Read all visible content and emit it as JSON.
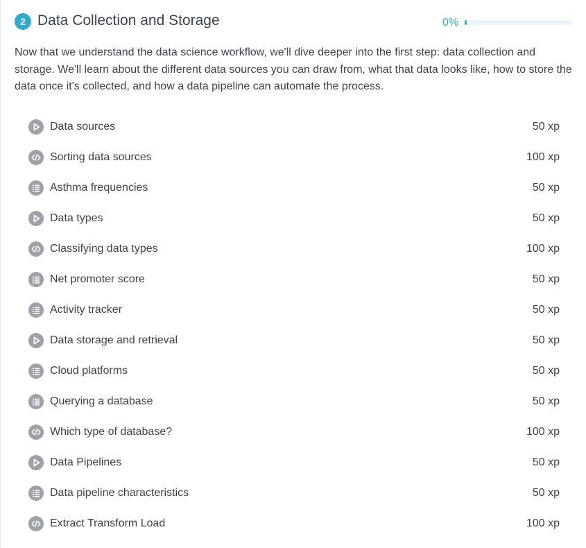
{
  "chapter": {
    "number": "2",
    "title": "Data Collection and Storage",
    "progress_label": "0%",
    "progress_value": 0,
    "accent_color": "#33aacc",
    "description": "Now that we understand the data science workflow, we'll dive deeper into the first step: data collection and storage. We'll learn about the different data sources you can draw from, what that data looks like, how to store the data once it's collected, and how a data pipeline can automate the process."
  },
  "exercises": [
    {
      "title": "Data sources",
      "xp": "50 xp",
      "icon": "video-play-icon"
    },
    {
      "title": "Sorting data sources",
      "xp": "100 xp",
      "icon": "code-icon"
    },
    {
      "title": "Asthma frequencies",
      "xp": "50 xp",
      "icon": "multiple-choice-list-icon"
    },
    {
      "title": "Data types",
      "xp": "50 xp",
      "icon": "video-play-icon"
    },
    {
      "title": "Classifying data types",
      "xp": "100 xp",
      "icon": "code-icon"
    },
    {
      "title": "Net promoter score",
      "xp": "50 xp",
      "icon": "multiple-choice-list-icon"
    },
    {
      "title": "Activity tracker",
      "xp": "50 xp",
      "icon": "multiple-choice-list-icon"
    },
    {
      "title": "Data storage and retrieval",
      "xp": "50 xp",
      "icon": "video-play-icon"
    },
    {
      "title": "Cloud platforms",
      "xp": "50 xp",
      "icon": "multiple-choice-list-icon"
    },
    {
      "title": "Querying a database",
      "xp": "50 xp",
      "icon": "multiple-choice-list-icon"
    },
    {
      "title": "Which type of database?",
      "xp": "100 xp",
      "icon": "code-icon"
    },
    {
      "title": "Data Pipelines",
      "xp": "50 xp",
      "icon": "video-play-icon"
    },
    {
      "title": "Data pipeline characteristics",
      "xp": "50 xp",
      "icon": "multiple-choice-list-icon"
    },
    {
      "title": "Extract Transform Load",
      "xp": "100 xp",
      "icon": "code-icon"
    }
  ]
}
